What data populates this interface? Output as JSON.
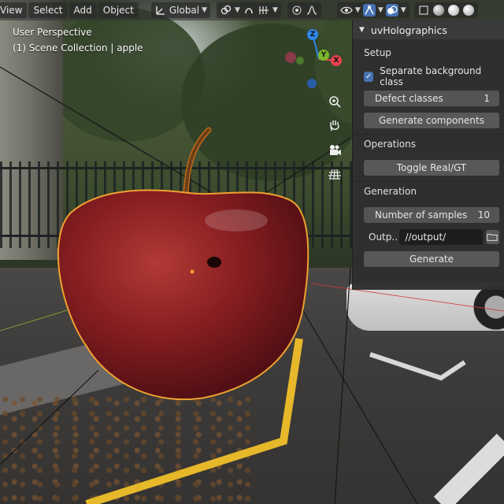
{
  "header": {
    "menu": [
      "View",
      "Select",
      "Add",
      "Object"
    ],
    "transform_orientation": "Global",
    "icons": [
      "axes-icon",
      "snap-icon",
      "proportional-edit-icon",
      "falloff-icon",
      "visibility-icon",
      "gizmo-icon",
      "overlay-icon",
      "xray-icon",
      "shading-solid-icon",
      "shading-material-icon",
      "shading-rendered-icon"
    ]
  },
  "viewport": {
    "perspective_label": "User Perspective",
    "collection_label": "(1) Scene Collection | apple"
  },
  "gizmo": {
    "z": "Z",
    "y": "Y",
    "x": "X",
    "colors": {
      "x": "#e8434f",
      "y": "#79b72a",
      "z": "#2f85e8"
    }
  },
  "nav_icons": [
    "zoom-icon",
    "hand-icon",
    "camera-icon",
    "grid-icon"
  ],
  "panel": {
    "title": "uvHolographics",
    "setup": {
      "heading": "Setup",
      "separate_bg_label": "Separate background class",
      "separate_bg_checked": true,
      "defect_classes_label": "Defect classes",
      "defect_classes_value": "1",
      "generate_components_label": "Generate components"
    },
    "operations": {
      "heading": "Operations",
      "toggle_label": "Toggle Real/GT"
    },
    "generation": {
      "heading": "Generation",
      "samples_label": "Number of samples",
      "samples_value": "10",
      "output_label": "Outp..",
      "output_value": "//output/",
      "generate_label": "Generate"
    }
  },
  "colors": {
    "accent": "#4772b3",
    "selection_outline": "#f0a030",
    "panel_bg": "#2e2e2e"
  }
}
